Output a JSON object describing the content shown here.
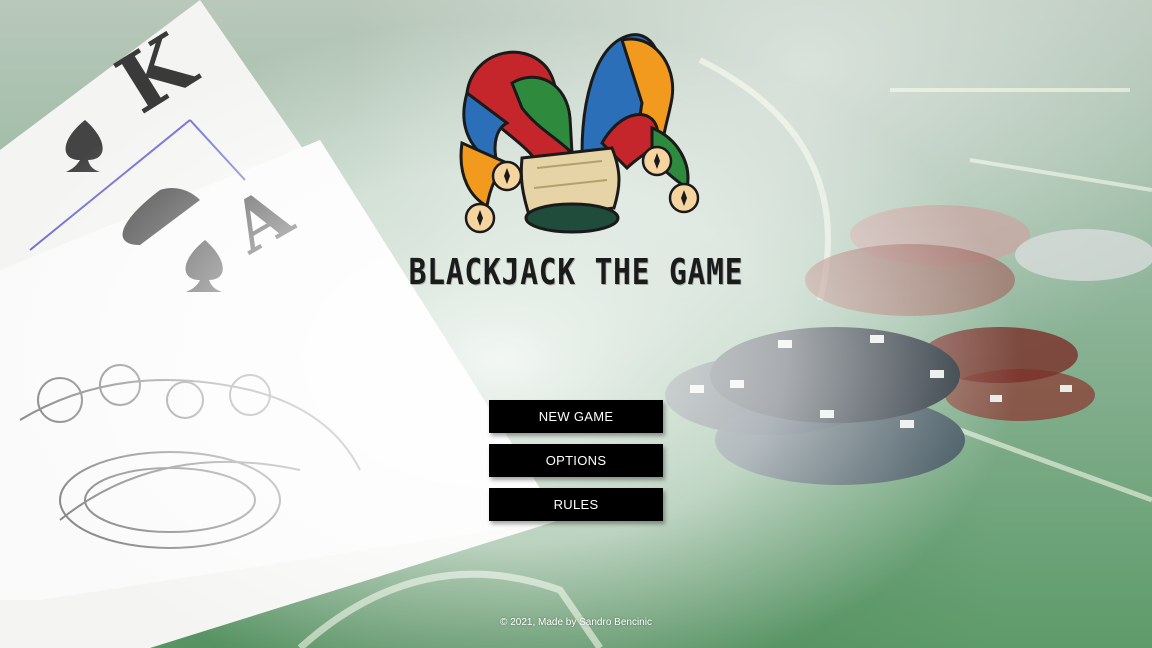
{
  "game": {
    "title": "BLACKJACK THE GAME"
  },
  "menu": {
    "new_game": "NEW GAME",
    "options": "OPTIONS",
    "rules": "RULES"
  },
  "footer": {
    "credit": "© 2021, Made by Sandro Bencinic"
  },
  "cards": {
    "king_rank": "K",
    "ace_rank": "A"
  },
  "colors": {
    "button_bg": "#000000",
    "button_text": "#ffffff",
    "felt_green": "#5e9b6a",
    "jester_red": "#c4262b",
    "jester_blue": "#2b6fb8",
    "jester_green": "#2e8b3e",
    "jester_orange": "#f29a1d"
  },
  "icons": {
    "logo": "jester-hat-icon",
    "chips": "poker-chips-icon",
    "playing_cards": "playing-cards-icon"
  }
}
